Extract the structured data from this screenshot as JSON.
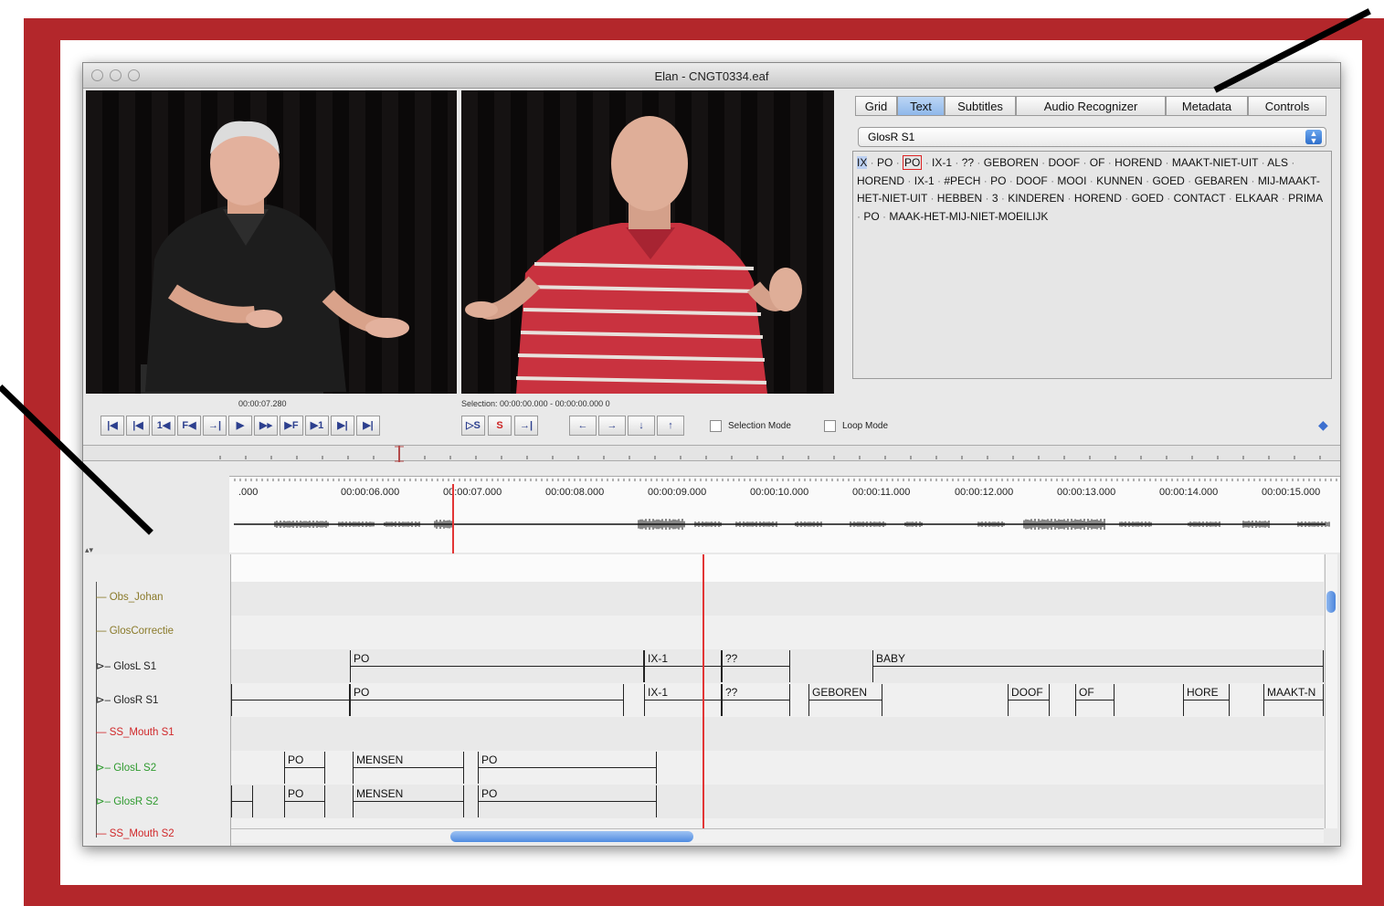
{
  "window": {
    "title": "Elan - CNGT0334.eaf",
    "traffic_colors": [
      "#e0463a",
      "#e9a629",
      "#5bb93c"
    ]
  },
  "side_panel": {
    "tabs": [
      "Grid",
      "Text",
      "Subtitles",
      "Audio Recognizer",
      "Metadata",
      "Controls"
    ],
    "active_tab": "Text",
    "tier_select": {
      "value": "GlosR S1"
    },
    "text": [
      "IX",
      "PO",
      "PO",
      "IX-1",
      "??",
      "GEBOREN",
      "DOOF",
      "OF",
      "HOREND",
      "MAAKT-NIET-UIT",
      "ALS",
      "HOREND",
      "IX-1",
      "#PECH",
      "PO",
      "DOOF",
      "MOOI",
      "KUNNEN",
      "GOED",
      "GEBAREN",
      "MIJ-MAAKT-HET-NIET-UIT",
      "HEBBEN",
      "3",
      "KINDEREN",
      "HOREND",
      "GOED",
      "CONTACT",
      "ELKAAR",
      "PRIMA",
      "PO",
      "MAAK-HET-MIJ-NIET-MOEILIJK"
    ],
    "highlight_blue_index": 0,
    "highlight_box_index": 2
  },
  "media": {
    "current_time": "00:00:07.280",
    "selection": "Selection: 00:00:00.000 - 00:00:00.000  0"
  },
  "controls": {
    "player_buttons": [
      "|◀",
      "|◀",
      "1◀",
      "F◀",
      "→|",
      "▶",
      "▶▸",
      "▶F",
      "▶1",
      "▶|",
      "▶|"
    ],
    "selection_buttons": [
      "▷S",
      "S",
      "→|"
    ],
    "nav_buttons": [
      "←",
      "→",
      "↓",
      "↑"
    ],
    "selection_mode_label": "Selection Mode",
    "loop_mode_label": "Loop Mode"
  },
  "waveform": {
    "ticks": [
      ".000",
      "00:00:06.000",
      "00:00:07.000",
      "00:00:08.000",
      "00:00:09.000",
      "00:00:10.000",
      "00:00:11.000",
      "00:00:12.000",
      "00:00:13.000",
      "00:00:14.000",
      "00:00:15.000",
      "00"
    ]
  },
  "timeline": {
    "ticks": [
      "00",
      "00:00:06.000",
      "00:00:07.000",
      "00:00:08.000",
      "00:00:09.000",
      "00:00:10.000",
      "00:00:11.000",
      "00:00:12.000"
    ],
    "tiers": [
      {
        "name": "Obs_Johan",
        "color": "#8a7a2a",
        "expand": false
      },
      {
        "name": "GlosCorrectie",
        "color": "#8a7a2a",
        "expand": false
      },
      {
        "name": "GlosL S1",
        "color": "#222222",
        "expand": true
      },
      {
        "name": "GlosR S1",
        "color": "#222222",
        "expand": true
      },
      {
        "name": "SS_Mouth S1",
        "color": "#d0282a",
        "expand": false
      },
      {
        "name": "GlosL S2",
        "color": "#2e9a2e",
        "expand": true
      },
      {
        "name": "GlosR S2",
        "color": "#2e9a2e",
        "expand": true
      },
      {
        "name": "SS_Mouth S2",
        "color": "#d0282a",
        "expand": false
      }
    ],
    "annotations": {
      "GlosL S1": [
        "PO",
        "IX-1",
        "??",
        "BABY"
      ],
      "GlosR S1": [
        "",
        "PO",
        "IX-1",
        "??",
        "GEBOREN",
        "DOOF",
        "OF",
        "HORE",
        "MAAKT-N"
      ],
      "GlosL S2": [
        "PO",
        "MENSEN",
        "PO"
      ],
      "GlosR S2": [
        "",
        "PO",
        "MENSEN",
        "PO"
      ]
    }
  }
}
